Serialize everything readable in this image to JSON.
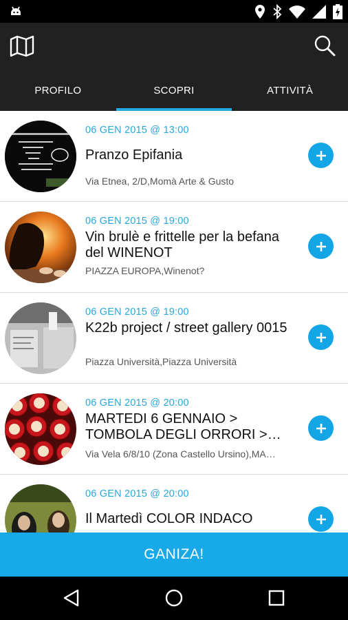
{
  "tabs": [
    "PROFILO",
    "SCOPRI",
    "ATTIVITÀ"
  ],
  "active_tab": 1,
  "events": [
    {
      "date": "06 GEN 2015 @ 13:00",
      "title": "Pranzo Epifania",
      "place": "Via Etnea, 2/D,Momà Arte & Gusto"
    },
    {
      "date": "06 GEN 2015 @ 19:00",
      "title": "Vin brulè e frittelle per la befana del WINENOT",
      "place": "PIAZZA EUROPA,Winenot?"
    },
    {
      "date": "06 GEN 2015 @ 19:00",
      "title": "K22b project / street gallery 0015",
      "place": "Piazza Università,Piazza Università"
    },
    {
      "date": "06 GEN 2015 @ 20:00",
      "title": "MARTEDI 6 GENNAIO > TOMBOLA DEGLI ORRORI >…",
      "place": "Via Vela 6/8/10 (Zona Castello Ursino),MA…"
    },
    {
      "date": "06 GEN 2015 @ 20:00",
      "title": "Il Martedì COLOR INDACO",
      "place": ""
    }
  ],
  "cta_label": "GANIZA!",
  "colors": {
    "accent": "#25a8e0",
    "appbar": "#212121",
    "cta": "#17a9e8"
  },
  "icons": {
    "appbar_left": "map-icon",
    "appbar_right": "search-icon",
    "row_action": "plus-icon"
  }
}
